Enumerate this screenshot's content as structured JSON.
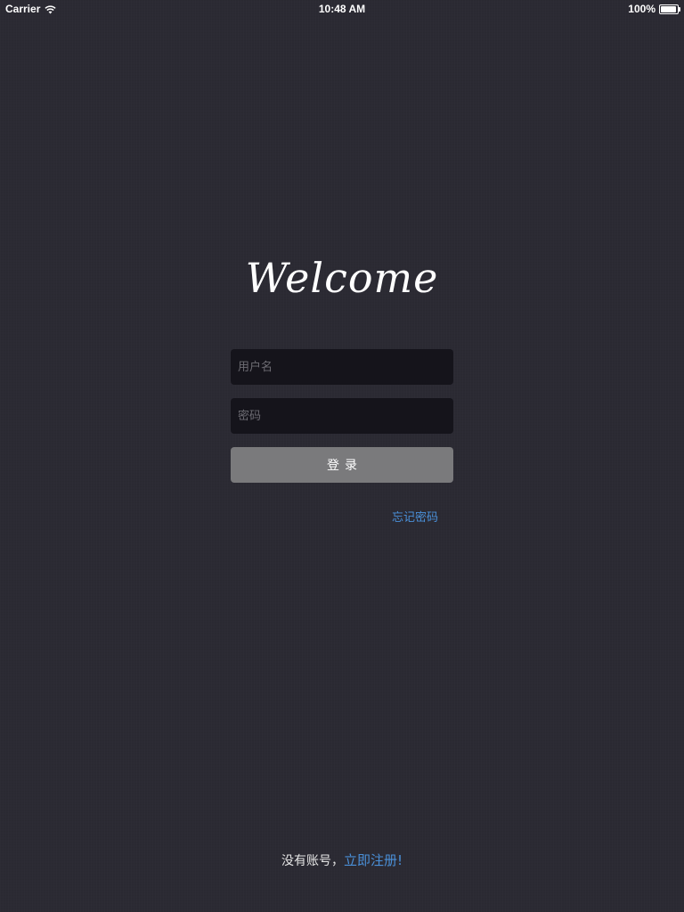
{
  "status_bar": {
    "carrier": "Carrier",
    "time": "10:48 AM",
    "battery": "100%",
    "battery_level": 1.0,
    "wifi_icon": "wifi-icon",
    "battery_icon": "battery-icon"
  },
  "login": {
    "title": "Welcome",
    "username_placeholder": "用户名",
    "username_value": "",
    "password_placeholder": "密码",
    "password_value": "",
    "login_button": "登录",
    "forgot_password": "忘记密码"
  },
  "footer": {
    "prompt": "没有账号，",
    "register_link": "立即注册!"
  },
  "colors": {
    "background": "#2b2a33",
    "input_background": "#15141b",
    "button_background": "#7a7a7c",
    "link": "#4a90d9"
  }
}
